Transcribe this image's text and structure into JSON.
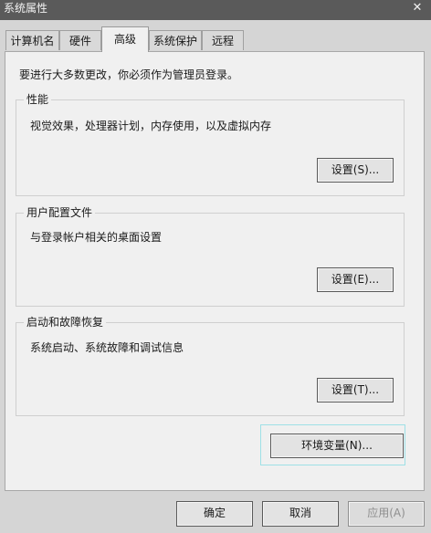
{
  "window": {
    "title": "系统属性",
    "close_glyph": "✕"
  },
  "tabs": [
    {
      "label": "计算机名"
    },
    {
      "label": "硬件"
    },
    {
      "label": "高级"
    },
    {
      "label": "系统保护"
    },
    {
      "label": "远程"
    }
  ],
  "advanced": {
    "notice": "要进行大多数更改，你必须作为管理员登录。",
    "performance": {
      "legend": "性能",
      "description": "视觉效果，处理器计划，内存使用，以及虚拟内存",
      "button": "设置(S)..."
    },
    "user_profiles": {
      "legend": "用户配置文件",
      "description": "与登录帐户相关的桌面设置",
      "button": "设置(E)..."
    },
    "startup_recovery": {
      "legend": "启动和故障恢复",
      "description": "系统启动、系统故障和调试信息",
      "button": "设置(T)..."
    },
    "env_vars_button": "环境变量(N)..."
  },
  "footer": {
    "ok": "确定",
    "cancel": "取消",
    "apply": "应用(A)"
  }
}
